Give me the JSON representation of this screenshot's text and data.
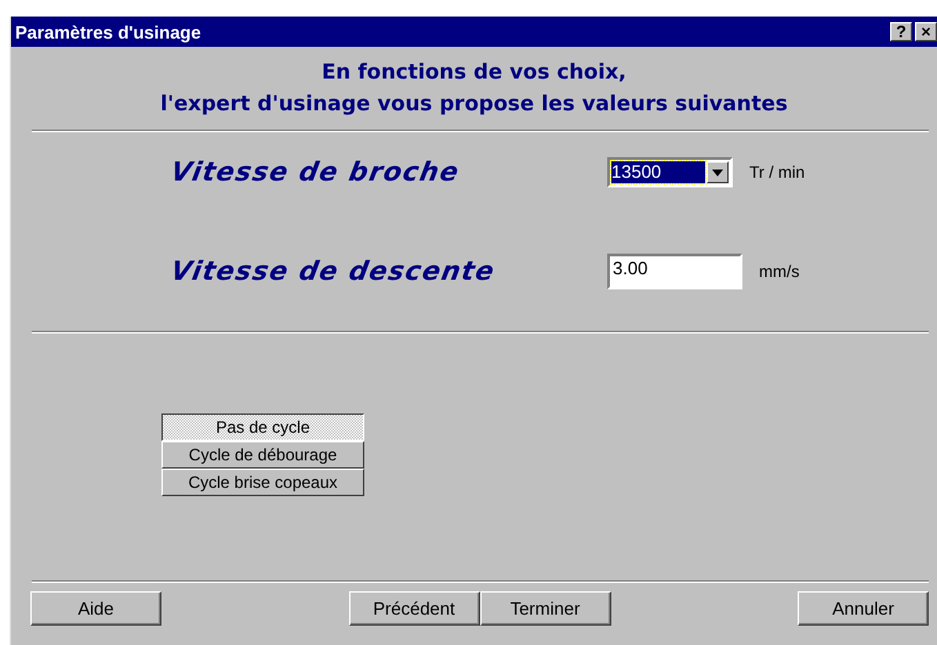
{
  "window": {
    "title": "Paramètres d'usinage",
    "title_buttons": [
      "?",
      "×"
    ]
  },
  "intro": [
    "En fonctions de vos choix,",
    "l'expert d'usinage vous propose les valeurs suivantes"
  ],
  "fields": [
    {
      "kind": "dropdown",
      "label": "Vitesse de broche",
      "value": "13500",
      "unit": "Tr / min"
    },
    {
      "kind": "input",
      "label": "Vitesse de descente",
      "value": "3.00",
      "unit": "mm/s"
    }
  ],
  "cycles": [
    {
      "label": "Pas de cycle",
      "selected": true
    },
    {
      "label": "Cycle de débourage",
      "selected": false
    },
    {
      "label": "Cycle brise copeaux",
      "selected": false
    }
  ],
  "buttons": {
    "left": [
      "Aide"
    ],
    "center": [
      "Précédent",
      "Terminer"
    ],
    "right": [
      "Annuler"
    ]
  }
}
